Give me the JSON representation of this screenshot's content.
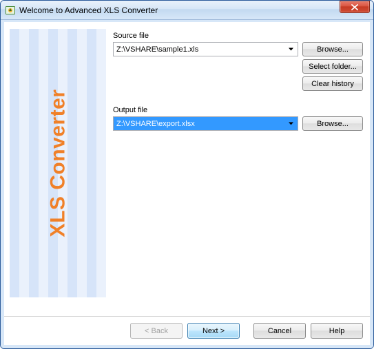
{
  "window": {
    "title": "Welcome to Advanced XLS Converter"
  },
  "sidebar": {
    "title": "XLS Converter"
  },
  "source": {
    "label": "Source file",
    "value": "Z:\\VSHARE\\sample1.xls",
    "browse": "Browse...",
    "select_folder": "Select folder...",
    "clear_history": "Clear history"
  },
  "output": {
    "label": "Output file",
    "value": "Z:\\VSHARE\\export.xlsx",
    "browse": "Browse..."
  },
  "footer": {
    "back": "< Back",
    "next": "Next >",
    "cancel": "Cancel",
    "help": "Help"
  }
}
